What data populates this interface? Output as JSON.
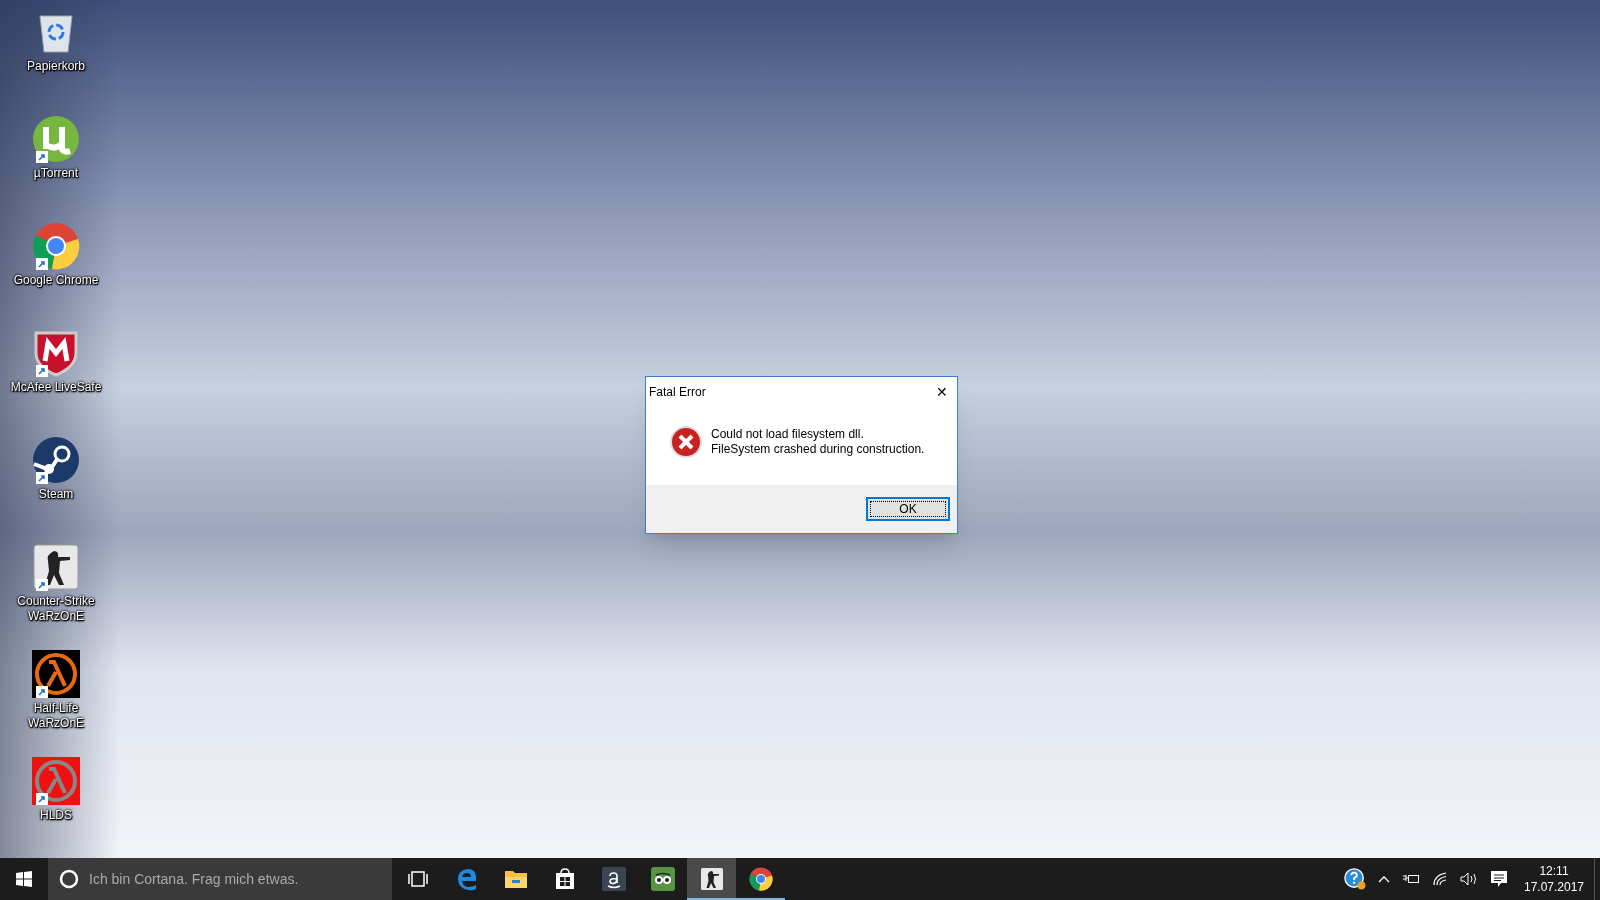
{
  "desktop_icons": [
    {
      "kind": "recycle",
      "label": "Papierkorb",
      "shortcut": false
    },
    {
      "kind": "torrent",
      "label": "µTorrent",
      "shortcut": true
    },
    {
      "kind": "chrome",
      "label": "Google Chrome",
      "shortcut": true
    },
    {
      "kind": "shield",
      "label": "McAfee LiveSafe",
      "shortcut": true
    },
    {
      "kind": "steam",
      "label": "Steam",
      "shortcut": true
    },
    {
      "kind": "soldier",
      "label": "Counter-Strike WaRzOnE",
      "shortcut": true
    },
    {
      "kind": "lambda",
      "label": "Half-Life WaRzOnE",
      "shortcut": true
    },
    {
      "kind": "lambda_red",
      "label": "HLDS",
      "shortcut": true
    }
  ],
  "dialog": {
    "title": "Fatal Error",
    "close": "✕",
    "message": [
      "Could not load filesystem dll.",
      "FileSystem crashed during construction."
    ],
    "buttons": [
      "OK"
    ]
  },
  "taskbar": {
    "search": {
      "placeholder": "Ich bin Cortana. Frag mich etwas."
    },
    "apps": [
      {
        "kind": "taskview",
        "running": false,
        "selected": false
      },
      {
        "kind": "edge",
        "running": false,
        "selected": false
      },
      {
        "kind": "explorer",
        "running": false,
        "selected": false
      },
      {
        "kind": "store",
        "running": false,
        "selected": false
      },
      {
        "kind": "amazon",
        "running": false,
        "selected": false
      },
      {
        "kind": "owl",
        "running": false,
        "selected": false
      },
      {
        "kind": "soldier",
        "running": true,
        "selected": true
      },
      {
        "kind": "chrome",
        "running": true,
        "selected": false
      }
    ],
    "tray": [
      {
        "kind": "help"
      },
      {
        "kind": "chevron"
      },
      {
        "kind": "power"
      },
      {
        "kind": "wifi"
      },
      {
        "kind": "volume"
      },
      {
        "kind": "notifications"
      }
    ],
    "clock": {
      "time": "12:11",
      "date": "17.07.2017"
    }
  }
}
